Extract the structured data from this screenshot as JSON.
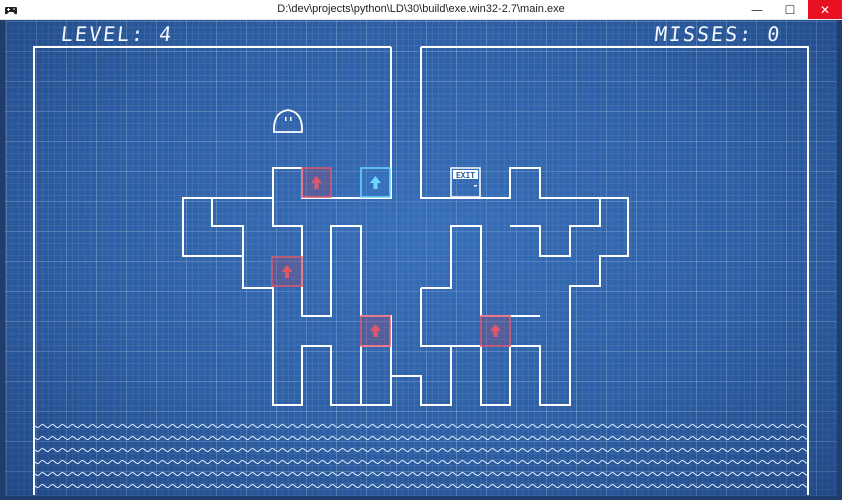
{
  "window": {
    "title": "D:\\dev\\projects\\python\\LD\\30\\build\\exe.win32-2.7\\main.exe",
    "minimize_glyph": "—",
    "maximize_glyph": "☐",
    "close_glyph": "✕",
    "icon": "gamepad-icon"
  },
  "hud": {
    "level_text": "LEVEL: 4",
    "misses_text": "MISSES: 0"
  },
  "level": {
    "exit_sign": "EXIT",
    "arrow_blocks": [
      {
        "color": "red",
        "direction": "up"
      },
      {
        "color": "blue",
        "direction": "up"
      },
      {
        "color": "red",
        "direction": "up"
      },
      {
        "color": "red",
        "direction": "up"
      },
      {
        "color": "red",
        "direction": "up"
      }
    ],
    "player": "blob-character",
    "hazard": "water"
  },
  "colors": {
    "background": "#2d60a6",
    "wall": "#ffffff",
    "arrow_red": "#e0566b",
    "arrow_blue": "#6ad8ff",
    "close_button": "#e81123"
  }
}
